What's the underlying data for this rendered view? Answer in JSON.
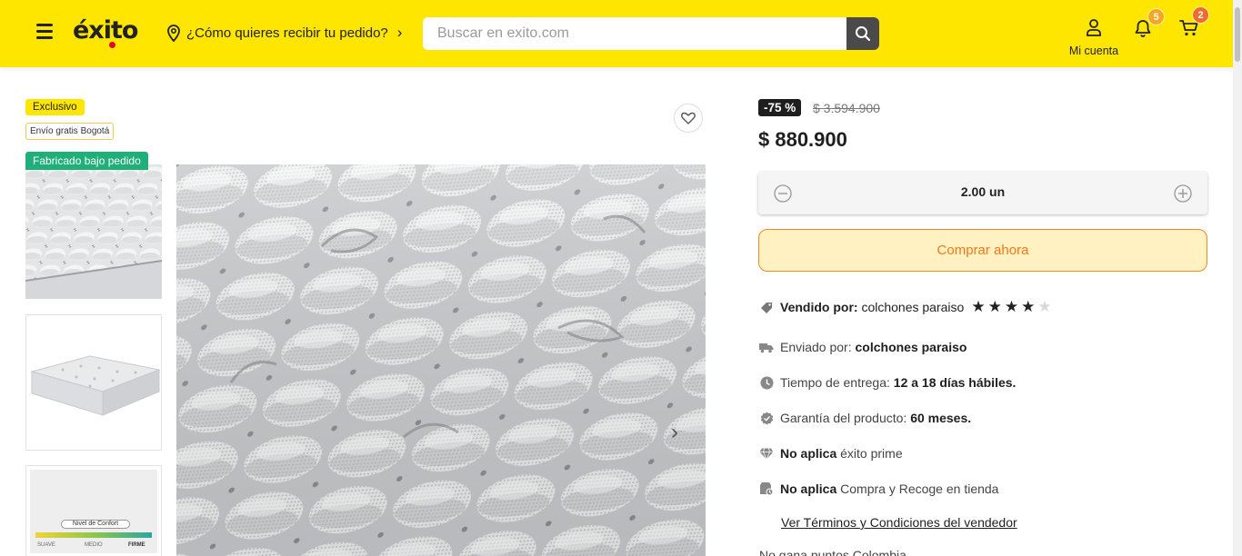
{
  "header": {
    "logo_text": "éxito",
    "location_prompt": "¿Cómo quieres recibir tu pedido?",
    "search_placeholder": "Buscar en exito.com",
    "account_label": "Mi cuenta",
    "notifications_count": "5",
    "cart_count": "2",
    "brand_color": "#ffe600"
  },
  "gallery": {
    "tag_exclusive": "Exclusivo",
    "tag_shipping": "Envío gratis Bogotá",
    "tag_made_to_order": "Fabricado bajo pedido",
    "thumb3_label_title": "Nivel de Confort",
    "thumb3_scale": [
      "SUAVE",
      "MEDIO",
      "FIRME"
    ]
  },
  "product": {
    "discount": "-75 %",
    "old_price": "$ 3.594.900",
    "price": "$ 880.900",
    "quantity": "2.00 un",
    "buy_label": "Comprar ahora",
    "sold_by_label": "Vendido por:",
    "sold_by_value": "colchones paraiso",
    "seller_rating": 4,
    "seller_rating_max": 5,
    "shipped_by_label": "Enviado por:",
    "shipped_by_value": "colchones paraiso",
    "delivery_label": "Tiempo de entrega:",
    "delivery_value": "12 a 18 días hábiles.",
    "warranty_label": "Garantía del producto:",
    "warranty_value": "60 meses.",
    "prime_label": "No aplica",
    "prime_value": "éxito prime",
    "pickup_label": "No aplica",
    "pickup_value": "Compra y Recoge en tienda",
    "terms_link": "Ver Términos y Condiciones del vendedor",
    "points_row": "No gana puntos Colombia"
  }
}
